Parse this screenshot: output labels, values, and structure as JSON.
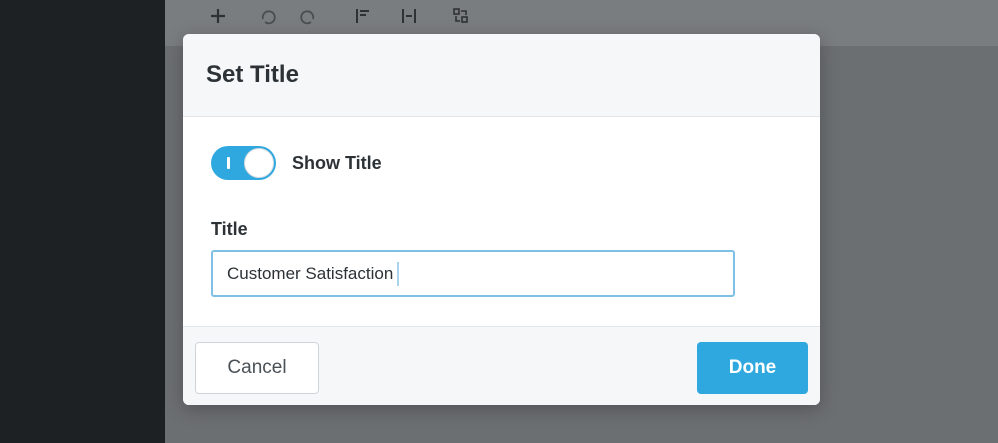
{
  "toolbar": {
    "icons": [
      "plus-icon",
      "undo-icon",
      "redo-icon",
      "align-left-icon",
      "align-center-icon",
      "layout-icon"
    ]
  },
  "dialog": {
    "title": "Set Title",
    "show_title_toggle": {
      "label": "Show Title",
      "on": true
    },
    "title_field": {
      "label": "Title",
      "value": "Customer Satisfaction"
    },
    "cancel_label": "Cancel",
    "done_label": "Done"
  },
  "colors": {
    "accent": "#2ea8df",
    "dark_panel": "#1d2123",
    "overlay": "#6c6f72"
  }
}
